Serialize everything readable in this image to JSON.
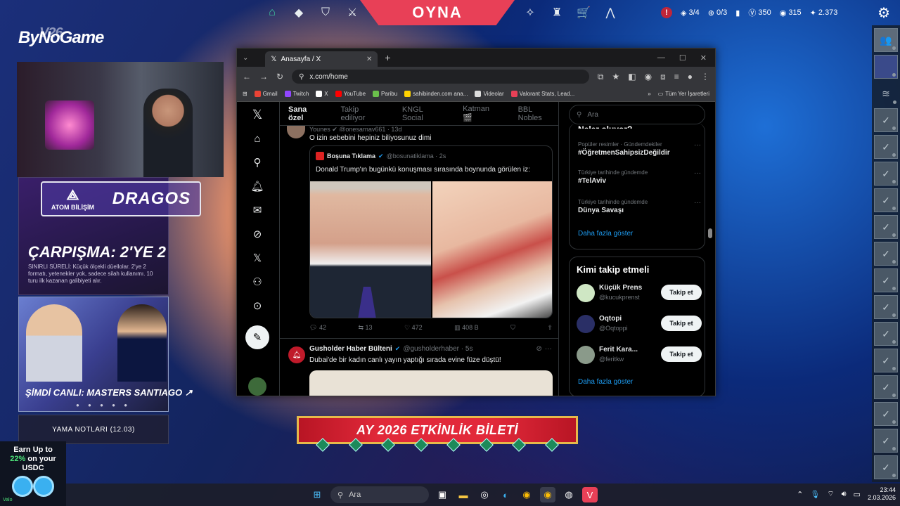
{
  "game": {
    "play_label": "OYNA",
    "left_icons": [
      "home-icon",
      "career-icon",
      "agents-icon",
      "collection-icon"
    ],
    "right_icons": [
      "battlepass-icon",
      "esports-icon",
      "store-icon",
      "rank-icon"
    ],
    "alert": "!",
    "party_count": "3/4",
    "kingdom_credits": "0/3",
    "vp": "350",
    "radianite": "315",
    "kingdom": "2.373"
  },
  "overlay": {
    "brand": "ByNoGame",
    "brand_version": "V26",
    "sponsor_small": "ATOM BİLİŞİM",
    "sponsor_big": "DRAGOS",
    "promo1_title": "ÇARPIŞMA: 2'YE 2",
    "promo1_desc": "SINIRLI SÜRELİ: Küçük ölçekli düellolar. 2'ye 2 formatı, yetenekler yok, sadece silah kullanımı. 10 turu ilk kazanan galibiyeti alır.",
    "promo2_title": "ŞİMDİ CANLI: MASTERS SANTIAGO ↗",
    "dots": "● ● ● ● ●",
    "patch_notes": "YAMA NOTLARI (12.03)",
    "event": "AY 2026 ETKİNLİK BİLETİ"
  },
  "ad": {
    "line1": "Earn Up to",
    "percent": "22%",
    "line2": "on your",
    "line3": "USDC",
    "footer": "Valo"
  },
  "browser": {
    "tab_title": "Anasayfa / X",
    "url": "x.com/home",
    "bookmarks": [
      {
        "label": "Gmail",
        "color": "#ea4335"
      },
      {
        "label": "Twitch",
        "color": "#9146ff"
      },
      {
        "label": "X",
        "color": "#ffffff"
      },
      {
        "label": "YouTube",
        "color": "#ff0000"
      },
      {
        "label": "Paribu",
        "color": "#6abf4b"
      },
      {
        "label": "sahibinden.com ana...",
        "color": "#ffd200"
      },
      {
        "label": "Videolar",
        "color": "#dddddd"
      },
      {
        "label": "Valorant Stats, Lead...",
        "color": "#e84057"
      }
    ],
    "all_bookmarks": "Tüm Yer İşaretleri"
  },
  "x": {
    "tabs": [
      "Sana özel",
      "Takip ediliyor",
      "KNGL Social",
      "Katman 🎬",
      "BBL Nobles"
    ],
    "search_placeholder": "Ara",
    "tweet1": {
      "header": "Younes ✔ @onesarnay661 · 13d",
      "text": "O izin sebebini hepiniz biliyosunuz dimi",
      "quote_name": "Boşuna Tıklama",
      "quote_handle": "@bosunatiklama · 2s",
      "quote_text": "Donald Trump'ın bugünkü konuşması sırasında boynunda görülen iz:",
      "replies": "42",
      "reposts": "13",
      "likes": "472",
      "views": "408 B"
    },
    "tweet2": {
      "name": "Gusholder Haber Bülteni",
      "handle": "@gusholderhaber · 5s",
      "text": "Dubai'de bir kadın canlı yayın yaptığı sırada evine füze düştü!"
    },
    "trends_title": "Neler oluyor?",
    "trends": [
      {
        "context": "Popüler resimler · Gündemdekiler",
        "topic": "#ÖğretmenSahipsizDeğildir"
      },
      {
        "context": "Türkiye tarihinde gündemde",
        "topic": "#TelAviv"
      },
      {
        "context": "Türkiye tarihinde gündemde",
        "topic": "Dünya Savaşı"
      }
    ],
    "show_more": "Daha fazla göster",
    "wtf_title": "Kimi takip etmeli",
    "follow_label": "Takip et",
    "suggestions": [
      {
        "name": "Küçük Prens",
        "handle": "@kucukprenst",
        "color": "#cfe7c4"
      },
      {
        "name": "Oqtopi",
        "handle": "@Oqtoppi",
        "color": "#2a2f66"
      },
      {
        "name": "Ferit Kara...",
        "handle": "@feritkw",
        "color": "#8a9a8a"
      }
    ]
  },
  "taskbar": {
    "search": "Ara",
    "time": "23:44",
    "date": "2.03.2026"
  }
}
